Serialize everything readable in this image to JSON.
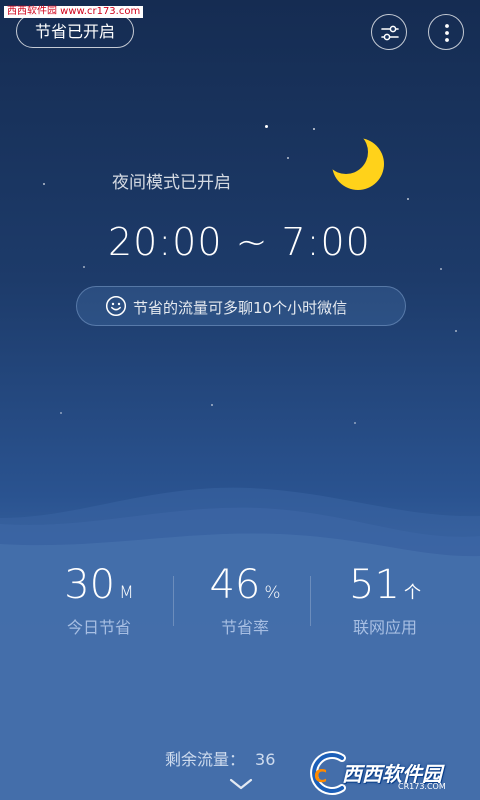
{
  "watermark": {
    "top_text": "西西软件园 www.cr173.com",
    "bottom_text": "西西软件园",
    "bottom_sub": "CR173.COM",
    "bottom_logo_letter": "C"
  },
  "header": {
    "status_label": "节省已开启",
    "filter_icon": "sliders-icon",
    "more_icon": "more-vertical-icon"
  },
  "night_mode": {
    "label": "夜间模式已开启",
    "time_range": "20:00 ~ 7:00",
    "moon_icon": "crescent-moon-icon",
    "moon_color": "#ffd21a"
  },
  "info": {
    "icon": "smile-icon",
    "text": "节省的流量可多聊10个小时微信"
  },
  "stats": [
    {
      "value": "30",
      "unit": "M",
      "label": "今日节省"
    },
    {
      "value": "46",
      "unit": "%",
      "label": "节省率"
    },
    {
      "value": "51",
      "unit": "个",
      "label": "联网应用"
    }
  ],
  "remaining": {
    "label": "剩余流量：",
    "value": "36"
  },
  "footer": {
    "expand_icon": "chevron-down-icon"
  }
}
